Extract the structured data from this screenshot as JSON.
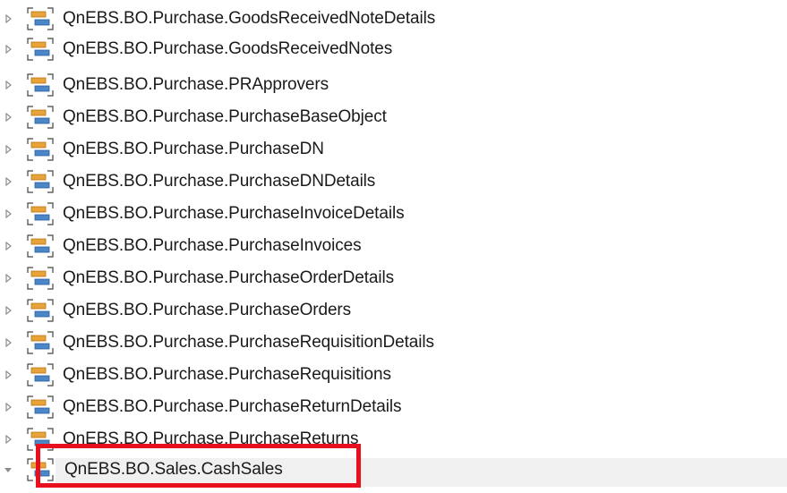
{
  "tree": {
    "items": [
      {
        "label": "QnEBS.BO.Purchase.GoodsReceivedNoteDetails",
        "expanded": false
      },
      {
        "label": "QnEBS.BO.Purchase.GoodsReceivedNotes",
        "expanded": false
      },
      {
        "label": "QnEBS.BO.Purchase.PRApprovers",
        "expanded": false
      },
      {
        "label": "QnEBS.BO.Purchase.PurchaseBaseObject",
        "expanded": false
      },
      {
        "label": "QnEBS.BO.Purchase.PurchaseDN",
        "expanded": false
      },
      {
        "label": "QnEBS.BO.Purchase.PurchaseDNDetails",
        "expanded": false
      },
      {
        "label": "QnEBS.BO.Purchase.PurchaseInvoiceDetails",
        "expanded": false
      },
      {
        "label": "QnEBS.BO.Purchase.PurchaseInvoices",
        "expanded": false
      },
      {
        "label": "QnEBS.BO.Purchase.PurchaseOrderDetails",
        "expanded": false
      },
      {
        "label": "QnEBS.BO.Purchase.PurchaseOrders",
        "expanded": false
      },
      {
        "label": "QnEBS.BO.Purchase.PurchaseRequisitionDetails",
        "expanded": false
      },
      {
        "label": "QnEBS.BO.Purchase.PurchaseRequisitions",
        "expanded": false
      },
      {
        "label": "QnEBS.BO.Purchase.PurchaseReturnDetails",
        "expanded": false
      },
      {
        "label": "QnEBS.BO.Purchase.PurchaseReturns",
        "expanded": false
      },
      {
        "label": "QnEBS.BO.Sales.CashSales",
        "expanded": true,
        "selected": true
      }
    ],
    "item_icon": "class-diagram-icon",
    "collapsed_icon": "expand-arrow-icon",
    "expanded_icon": "collapse-arrow-icon"
  },
  "annotation": {
    "color": "#e8101e"
  },
  "colors": {
    "icon_blue": "#4a86c8",
    "icon_orange": "#e8a33a",
    "arrow": "#8c8c8c"
  }
}
